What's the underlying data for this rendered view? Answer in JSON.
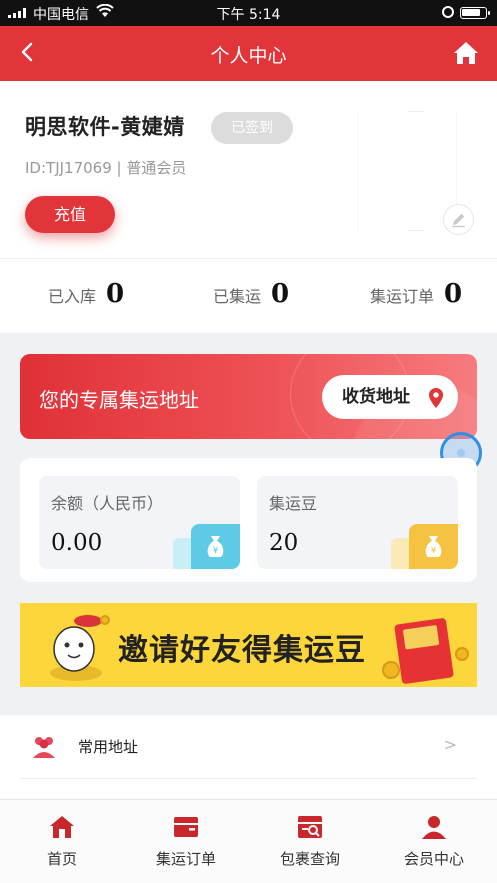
{
  "status_bar": {
    "carrier": "中国电信",
    "time": "下午 5:14"
  },
  "nav": {
    "title": "个人中心"
  },
  "profile": {
    "name": "明思软件-黄婕婧",
    "signed_label": "已签到",
    "id_text": "ID:TJJ17069",
    "separator": "|",
    "member_level": "普通会员",
    "recharge_label": "充值"
  },
  "stats": [
    {
      "label": "已入库",
      "value": "0"
    },
    {
      "label": "已集运",
      "value": "0"
    },
    {
      "label": "集运订单",
      "value": "0"
    }
  ],
  "address_banner": {
    "text": "您的专属集运地址",
    "button_label": "收货地址"
  },
  "wallet": [
    {
      "label": "余额（人民币）",
      "value": "0.00",
      "icon": "money-bag-icon",
      "color": "#5dcbe6"
    },
    {
      "label": "集运豆",
      "value": "20",
      "icon": "bean-bag-icon",
      "color": "#f5c241"
    }
  ],
  "promo": {
    "text": "邀请好友得集运豆"
  },
  "menu": [
    {
      "label": "常用地址",
      "arrow": ">"
    }
  ],
  "tabs": [
    {
      "label": "首页",
      "icon": "home-icon"
    },
    {
      "label": "集运订单",
      "icon": "order-icon"
    },
    {
      "label": "包裹查询",
      "icon": "package-search-icon"
    },
    {
      "label": "会员中心",
      "icon": "member-icon"
    }
  ],
  "colors": {
    "brand": "#e2353a",
    "tab_icon": "#c8272c"
  }
}
